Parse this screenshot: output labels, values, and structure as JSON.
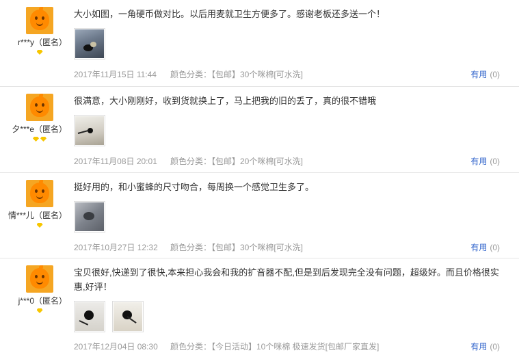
{
  "reviews": [
    {
      "username": "r***y（匿名）",
      "level": 1,
      "text": "大小如图，一角硬币做对比。以后用麦就卫生方便多了。感谢老板还多送一个！",
      "date": "2017年11月15日 11:44",
      "sku": "颜色分类：【包邮】30个咪棉[可水洗]",
      "useful_label": "有用",
      "useful_count": "(0)"
    },
    {
      "username": "夕***e（匿名）",
      "level": 2,
      "text": "很满意，大小刚刚好，收到货就换上了，马上把我的旧的丢了，真的很不错哦",
      "date": "2017年11月08日 20:01",
      "sku": "颜色分类：【包邮】20个咪棉[可水洗]",
      "useful_label": "有用",
      "useful_count": "(0)"
    },
    {
      "username": "情***儿（匿名）",
      "level": 1,
      "text": "挺好用的，和小蜜蜂的尺寸吻合，每周换一个感觉卫生多了。",
      "date": "2017年10月27日 12:32",
      "sku": "颜色分类：【包邮】30个咪棉[可水洗]",
      "useful_label": "有用",
      "useful_count": "(0)"
    },
    {
      "username": "j***0（匿名）",
      "level": 1,
      "text": "宝贝很好,快递到了很快,本来担心我会和我的扩音器不配,但是到后发现完全没有问题，超级好。而且价格很实惠,好评！",
      "date": "2017年12月04日 08:30",
      "sku": "颜色分类：【今日活动】10个咪棉 极速发货[包邮厂家直发]",
      "useful_label": "有用",
      "useful_count": "(0)"
    }
  ]
}
